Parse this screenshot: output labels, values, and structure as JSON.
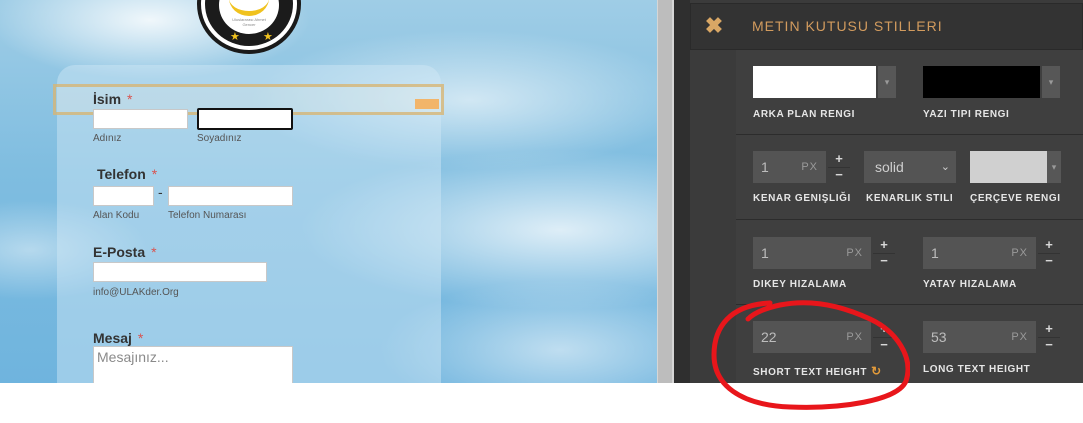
{
  "form": {
    "name_label": "İsim",
    "required_mark": "*",
    "first_name_sub": "Adınız",
    "last_name_sub": "Soyadınız",
    "phone_label": "Telefon",
    "phone_dash": "-",
    "area_code_sub": "Alan Kodu",
    "phone_number_sub": "Telefon Numarası",
    "email_label": "E-Posta",
    "email_sub": "info@ULAKder.Org",
    "message_label": "Mesaj",
    "message_placeholder": "Mesajınız..."
  },
  "panel": {
    "title": "METIN KUTUSU STILLERI",
    "colors": {
      "background": "#ffffff",
      "font": "#000000",
      "border": "#d0d0d0",
      "accent": "#d29b5e"
    },
    "bg_color_label": "ARKA PLAN RENGI",
    "font_color_label": "YAZI TIPI RENGI",
    "border_width_value": "1",
    "border_width_label": "KENAR GENIŞLIĞI",
    "border_style_value": "solid",
    "border_style_label": "KENARLIK STILI",
    "frame_color_label": "ÇERÇEVE RENGI",
    "vertical_value": "1",
    "vertical_label": "DIKEY HIZALAMA",
    "horizontal_value": "1",
    "horizontal_label": "YATAY HIZALAMA",
    "short_height_value": "22",
    "short_height_label": "SHORT TEXT HEIGHT",
    "long_height_value": "53",
    "long_height_label": "LONG TEXT HEIGHT",
    "unit": "PX",
    "plus": "+",
    "minus": "−",
    "close_glyph": "✖",
    "dropdown_glyph": "▾",
    "reset_glyph": "↻"
  }
}
